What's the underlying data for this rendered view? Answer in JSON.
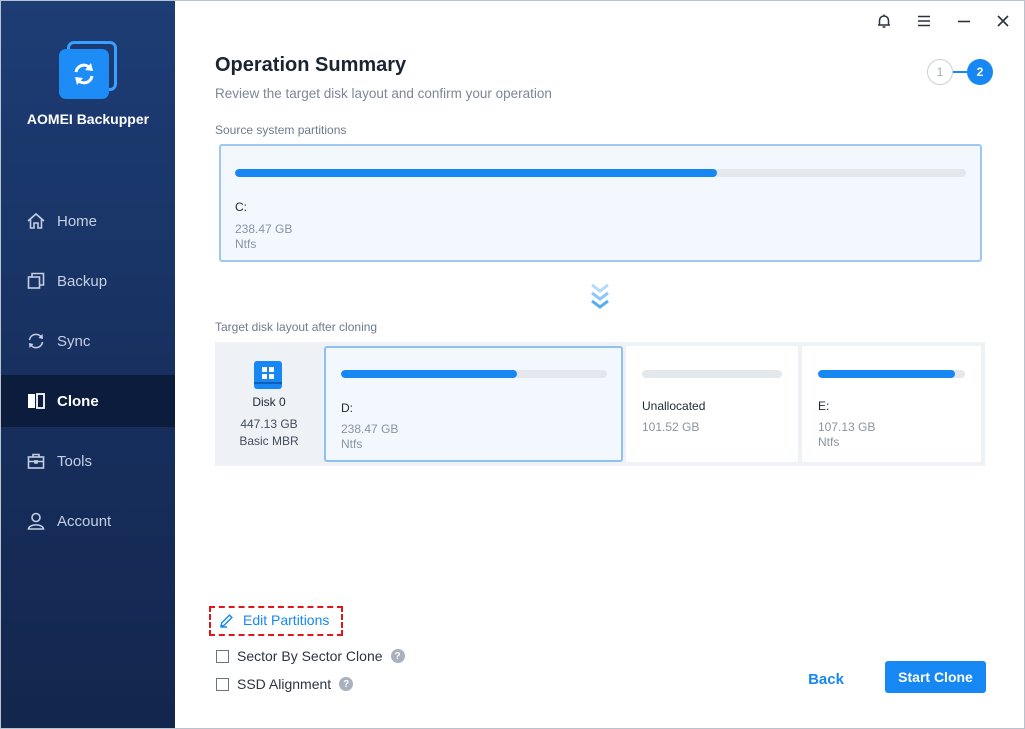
{
  "app": {
    "name": "AOMEI Backupper"
  },
  "sidebar": {
    "items": [
      {
        "label": "Home",
        "icon": "home-icon",
        "active": false
      },
      {
        "label": "Backup",
        "icon": "backup-icon",
        "active": false
      },
      {
        "label": "Sync",
        "icon": "sync-icon",
        "active": false
      },
      {
        "label": "Clone",
        "icon": "clone-icon",
        "active": true
      },
      {
        "label": "Tools",
        "icon": "tools-icon",
        "active": false
      },
      {
        "label": "Account",
        "icon": "account-icon",
        "active": false
      }
    ]
  },
  "titlebar": {
    "icons": [
      "bell-icon",
      "menu-icon",
      "minimize-icon",
      "close-icon"
    ]
  },
  "header": {
    "title": "Operation Summary",
    "subtitle": "Review the target disk layout and confirm your operation",
    "steps": [
      "1",
      "2"
    ],
    "current_step": 2
  },
  "source": {
    "label": "Source system partitions",
    "partition": {
      "name": "C:",
      "size": "238.47 GB",
      "fs": "Ntfs",
      "used_fraction": 0.66
    }
  },
  "target": {
    "label": "Target disk layout after cloning",
    "disk": {
      "name": "Disk 0",
      "size": "447.13 GB",
      "type": "Basic MBR"
    },
    "partitions": [
      {
        "name": "D:",
        "size": "238.47 GB",
        "fs": "Ntfs",
        "used_fraction": 0.66,
        "selected": true
      },
      {
        "name": "Unallocated",
        "size": "101.52 GB",
        "fs": "",
        "used_fraction": 0,
        "selected": false
      },
      {
        "name": "E:",
        "size": "107.13 GB",
        "fs": "Ntfs",
        "used_fraction": 0.93,
        "selected": false
      }
    ]
  },
  "options": {
    "edit_partitions": "Edit Partitions",
    "sector_by_sector": "Sector By Sector Clone",
    "ssd_alignment": "SSD Alignment",
    "help_glyph": "?"
  },
  "buttons": {
    "back": "Back",
    "start": "Start Clone"
  },
  "colors": {
    "accent": "#1787f3",
    "sidebar": "#172f5e",
    "highlight_box": "#e0161b"
  }
}
